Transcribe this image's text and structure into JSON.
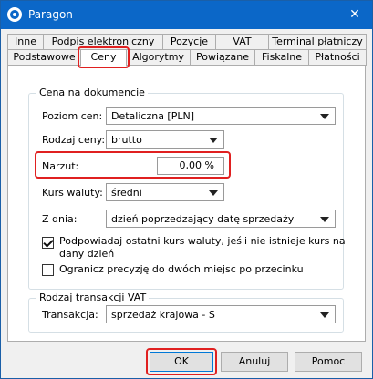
{
  "window": {
    "title": "Paragon",
    "close_glyph": "✕",
    "app_icon": "paragon-logo-icon"
  },
  "tabs": {
    "row1": [
      "Inne",
      "Podpis elektroniczny",
      "Pozycje",
      "VAT",
      "Terminal płatniczy"
    ],
    "row2": [
      "Podstawowe",
      "Ceny",
      "Algorytmy",
      "Powiązane",
      "Fiskalne",
      "Płatności"
    ],
    "active": "Ceny"
  },
  "price_group": {
    "legend": "Cena na dokumencie",
    "price_level_label": "Poziom cen:",
    "price_level_value": "Detaliczna [PLN]",
    "price_type_label": "Rodzaj ceny:",
    "price_type_value": "brutto",
    "markup_label": "Narzut:",
    "markup_value": "0,00 %",
    "rate_label": "Kurs waluty:",
    "rate_value": "średni",
    "date_label": "Z dnia:",
    "date_value": "dzień poprzedzający datę sprzedaży",
    "suggest_rate_line1": "Podpowiadaj ostatni kurs waluty, jeśli nie istnieje kurs na",
    "suggest_rate_line2": "dany dzień",
    "suggest_rate_checked": true,
    "limit_precision_label": "Ogranicz precyzję do dwóch miejsc po przecinku",
    "limit_precision_checked": false
  },
  "vat_group": {
    "legend": "Rodzaj transakcji VAT",
    "transaction_label": "Transakcja:",
    "transaction_value": "sprzedaż krajowa - S"
  },
  "buttons": {
    "ok": "OK",
    "cancel": "Anuluj",
    "help": "Pomoc"
  },
  "colors": {
    "titlebar": "#0b67c8",
    "highlight": "#e02020"
  }
}
